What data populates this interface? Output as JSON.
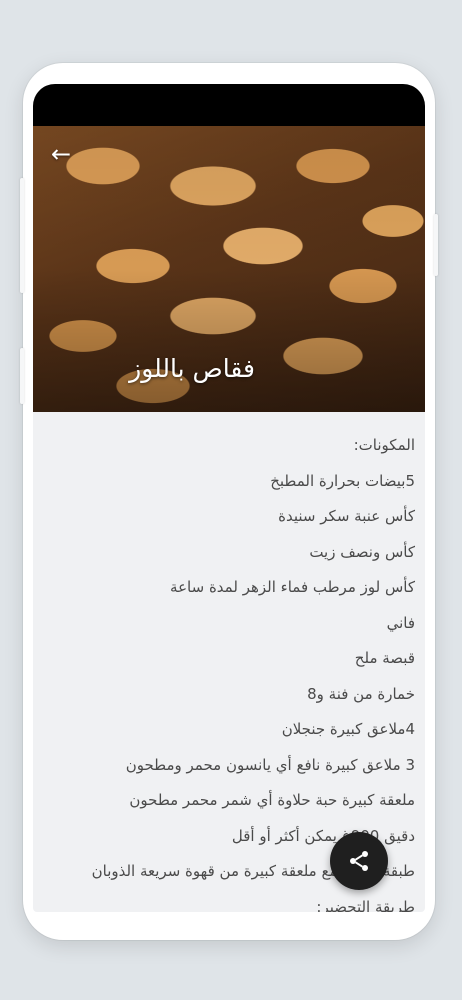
{
  "recipe": {
    "title": "فقاص باللوز",
    "lines": [
      "المكونات:",
      "5بيضات بحرارة المطبخ",
      "كأس عنبة سكر سنيدة",
      "كأس ونصف زيت",
      "كأس لوز مرطب فماء الزهر لمدة ساعة",
      "فاني",
      "قبصة ملح",
      "خمارة من فنة و8",
      "4ملاعق كبيرة جنجلان",
      "3 ملاعق كبيرة نافع أي يانسون محمر ومطحون",
      "ملعقة كبيرة حبة حلاوة أي شمر محمر مطحون",
      "دقيق 900غ يمكن أكثر أو أقل",
      "طبقة ملعقة مع ملعقة كبيرة من قهوة سريعة الذوبان",
      "طريقة التحضير:"
    ]
  },
  "icons": {
    "back": "back-arrow-icon",
    "share": "share-icon"
  },
  "colors": {
    "fab": "#1f1f1f",
    "text": "#4a4a4a",
    "background": "#f0f1f3"
  }
}
